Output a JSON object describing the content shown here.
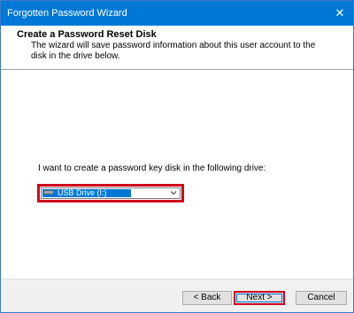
{
  "window": {
    "title": "Forgotten Password Wizard",
    "close_glyph": "✕"
  },
  "header": {
    "title": "Create a Password Reset Disk",
    "description": "The wizard will save password information about this user account to the disk in the drive below."
  },
  "body": {
    "prompt": "I want to create a password key disk in the following drive:",
    "drive_select": {
      "selected": "USB Drive (I:)",
      "icon": "usb-drive-icon"
    }
  },
  "buttons": {
    "back_label": "< Back",
    "next_label": "Next >",
    "cancel_label": "Cancel"
  },
  "colors": {
    "titlebar": "#0078d7",
    "highlight": "#d0021b",
    "selection": "#0078d7"
  }
}
